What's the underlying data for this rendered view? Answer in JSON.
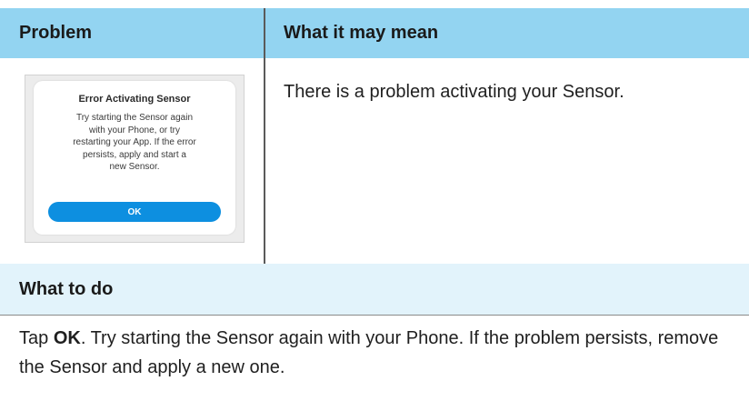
{
  "table": {
    "header": {
      "problem": "Problem",
      "meaning": "What it may mean"
    },
    "row": {
      "meaning_text": "There is a problem activating your Sensor.",
      "dialog": {
        "title": "Error Activating Sensor",
        "message": "Try starting the Sensor again\nwith your Phone, or try\nrestarting your App. If the error\npersists, apply and start a\nnew Sensor.",
        "ok_label": "OK"
      }
    },
    "what_to_do": {
      "title": "What to do",
      "instr_prefix": "Tap ",
      "instr_bold": "OK",
      "instr_suffix": ". Try starting the Sensor again with your Phone. If the problem persists, remove the Sensor and apply a new one."
    }
  },
  "colors": {
    "header_bg": "#93d4f1",
    "todo_bg": "#e2f3fb",
    "ok_button": "#0d8fe0"
  }
}
